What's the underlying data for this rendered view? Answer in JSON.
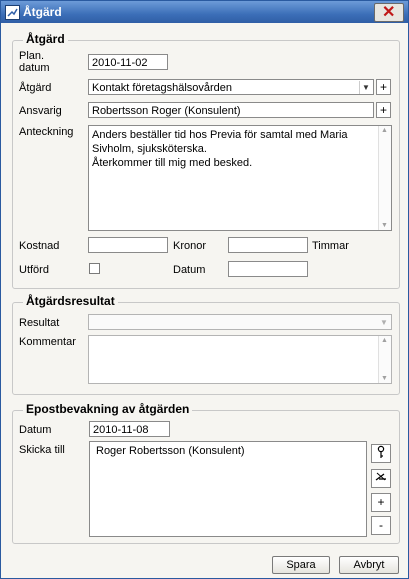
{
  "window": {
    "title": "Åtgärd",
    "close_glyph": "✕"
  },
  "atgard_group": {
    "legend": "Åtgärd",
    "plan_label": "Plan.\ndatum",
    "plan_value": "2010-11-02",
    "atgard_label": "Åtgärd",
    "atgard_value": "Kontakt företagshälsovården",
    "ansvarig_label": "Ansvarig",
    "ansvarig_value": "Robertsson Roger (Konsulent)",
    "anteckning_label": "Anteckning",
    "anteckning_value": "Anders beställer tid hos Previa för samtal med Maria Sivholm, sjuksköterska.\nÅterkommer till mig med besked.",
    "kostnad_label": "Kostnad",
    "kronor_label": "Kronor",
    "timmar_label": "Timmar",
    "kostnad_value": "",
    "timmar_value": "",
    "utford_label": "Utförd",
    "utford_checked": false,
    "datum_label": "Datum",
    "datum_value": ""
  },
  "resultat_group": {
    "legend": "Åtgärdsresultat",
    "resultat_label": "Resultat",
    "resultat_value": "",
    "kommentar_label": "Kommentar",
    "kommentar_value": ""
  },
  "epost_group": {
    "legend": "Epostbevakning av åtgärden",
    "datum_label": "Datum",
    "datum_value": "2010-11-08",
    "skicka_label": "Skicka till",
    "recipients": [
      "Roger Robertsson (Konsulent)"
    ],
    "add_glyph": "+",
    "remove_glyph": "-"
  },
  "buttons": {
    "save": "Spara",
    "cancel": "Avbryt"
  },
  "icons": {
    "dropdown": "chevron-down-icon",
    "plus": "plus-icon",
    "key": "key-icon",
    "unlink": "unlink-icon"
  },
  "colors": {
    "titlebar": "#3c6fb8",
    "close": "#c01818",
    "background": "#f6f5f1"
  }
}
